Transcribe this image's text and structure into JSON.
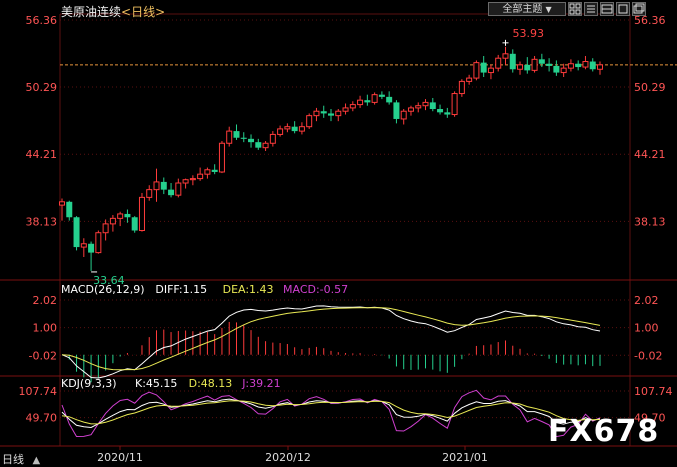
{
  "header": {
    "instrument": "美原油连续",
    "period": "<日线>",
    "theme_button": "全部主题",
    "theme_arrow": "▼"
  },
  "icons": [
    "grid-icon",
    "list-icon",
    "chart-layout-icon",
    "fullscreen-icon",
    "window-icon"
  ],
  "colors": {
    "up": "#ff3b3b",
    "down": "#25d08e",
    "diff": "#ffffff",
    "dea": "#e8e854",
    "macd": "#d040d0",
    "kdj_k": "#ffffff",
    "kdj_d": "#e8e854",
    "kdj_j": "#d040d0",
    "last_price_line": "#e8953c",
    "grid": "#5a1010"
  },
  "watermark": "FX678",
  "footer": {
    "period_label": "日线",
    "scroll_arrow": "▲"
  },
  "chart_data": [
    {
      "type": "candlestick",
      "panel": "price",
      "y_ticks": [
        "56.36",
        "50.29",
        "44.21",
        "38.13"
      ],
      "ylim": [
        33.0,
        56.36
      ],
      "x_ticks": [
        "2020/11",
        "2020/12",
        "2021/01"
      ],
      "high_label": "53.93",
      "low_label": "33.64",
      "last_price": 52.3,
      "candles": [
        [
          39.6,
          40.2,
          38.2,
          39.9
        ],
        [
          39.9,
          40.0,
          38.2,
          38.5
        ],
        [
          38.5,
          38.6,
          35.5,
          35.8
        ],
        [
          35.8,
          36.6,
          34.9,
          36.1
        ],
        [
          36.1,
          36.3,
          33.64,
          35.3
        ],
        [
          35.3,
          37.3,
          35.2,
          37.1
        ],
        [
          37.1,
          38.3,
          36.4,
          37.9
        ],
        [
          37.9,
          38.7,
          37.2,
          38.4
        ],
        [
          38.4,
          39.0,
          37.7,
          38.8
        ],
        [
          38.8,
          39.2,
          38.0,
          38.5
        ],
        [
          38.5,
          38.6,
          37.1,
          37.3
        ],
        [
          37.3,
          40.7,
          37.2,
          40.3
        ],
        [
          40.3,
          41.4,
          40.0,
          41.0
        ],
        [
          41.0,
          42.9,
          39.9,
          41.7
        ],
        [
          41.7,
          42.1,
          40.6,
          41.0
        ],
        [
          41.0,
          41.6,
          40.3,
          40.5
        ],
        [
          40.5,
          42.0,
          40.3,
          41.6
        ],
        [
          41.6,
          42.0,
          41.1,
          41.9
        ],
        [
          41.9,
          42.3,
          41.4,
          42.0
        ],
        [
          42.0,
          43.0,
          41.8,
          42.4
        ],
        [
          42.4,
          43.0,
          42.0,
          42.8
        ],
        [
          42.8,
          43.3,
          42.4,
          42.6
        ],
        [
          42.6,
          45.4,
          42.5,
          45.2
        ],
        [
          45.2,
          46.7,
          44.9,
          46.3
        ],
        [
          46.3,
          46.9,
          45.5,
          45.7
        ],
        [
          45.7,
          46.2,
          45.3,
          45.6
        ],
        [
          45.6,
          46.0,
          44.8,
          45.3
        ],
        [
          45.3,
          45.6,
          44.6,
          44.8
        ],
        [
          44.8,
          45.4,
          44.5,
          45.2
        ],
        [
          45.2,
          46.3,
          44.9,
          46.0
        ],
        [
          46.0,
          46.8,
          45.8,
          46.5
        ],
        [
          46.5,
          47.0,
          46.2,
          46.7
        ],
        [
          46.7,
          47.2,
          46.1,
          46.3
        ],
        [
          46.3,
          47.1,
          46.0,
          46.7
        ],
        [
          46.7,
          47.9,
          46.5,
          47.7
        ],
        [
          47.7,
          48.4,
          47.2,
          48.1
        ],
        [
          48.1,
          48.6,
          47.5,
          47.9
        ],
        [
          47.9,
          48.3,
          47.2,
          47.7
        ],
        [
          47.7,
          48.3,
          47.2,
          48.1
        ],
        [
          48.1,
          48.8,
          47.8,
          48.4
        ],
        [
          48.4,
          49.0,
          48.1,
          48.7
        ],
        [
          48.7,
          49.5,
          48.4,
          49.1
        ],
        [
          49.1,
          49.6,
          48.6,
          48.9
        ],
        [
          48.9,
          49.8,
          48.7,
          49.6
        ],
        [
          49.6,
          49.9,
          49.2,
          49.4
        ],
        [
          49.4,
          49.9,
          48.7,
          48.9
        ],
        [
          48.9,
          49.1,
          47.0,
          47.4
        ],
        [
          47.4,
          48.3,
          46.9,
          48.1
        ],
        [
          48.1,
          48.6,
          47.7,
          48.4
        ],
        [
          48.4,
          48.9,
          48.0,
          48.6
        ],
        [
          48.6,
          49.2,
          48.2,
          48.9
        ],
        [
          48.9,
          49.3,
          48.1,
          48.3
        ],
        [
          48.3,
          48.7,
          47.8,
          48.0
        ],
        [
          48.0,
          48.4,
          47.5,
          47.8
        ],
        [
          47.8,
          49.9,
          47.6,
          49.7
        ],
        [
          49.7,
          51.0,
          49.4,
          50.8
        ],
        [
          50.8,
          51.4,
          50.5,
          51.1
        ],
        [
          51.1,
          52.7,
          50.9,
          52.5
        ],
        [
          52.5,
          53.1,
          51.2,
          51.6
        ],
        [
          51.6,
          52.3,
          51.0,
          52.0
        ],
        [
          52.0,
          53.2,
          51.7,
          52.9
        ],
        [
          52.9,
          53.93,
          52.3,
          53.3
        ],
        [
          53.3,
          53.7,
          51.6,
          51.9
        ],
        [
          51.9,
          52.6,
          51.4,
          52.3
        ],
        [
          52.3,
          53.0,
          51.5,
          51.8
        ],
        [
          51.8,
          53.1,
          51.6,
          52.8
        ],
        [
          52.8,
          53.3,
          52.1,
          52.4
        ],
        [
          52.4,
          52.9,
          51.7,
          52.2
        ],
        [
          52.2,
          52.7,
          51.3,
          51.6
        ],
        [
          51.6,
          52.4,
          51.2,
          52.0
        ],
        [
          52.0,
          52.8,
          51.7,
          52.4
        ],
        [
          52.4,
          52.7,
          51.8,
          52.1
        ],
        [
          52.1,
          53.1,
          51.9,
          52.6
        ],
        [
          52.6,
          52.9,
          51.7,
          51.9
        ],
        [
          51.9,
          52.6,
          51.4,
          52.3
        ]
      ]
    },
    {
      "type": "bar+line",
      "panel": "macd",
      "label": "MACD(26,12,9)",
      "diff_label": "DIFF:1.15",
      "dea_label": "DEA:1.43",
      "macd_label": "MACD:-0.57",
      "y_ticks": [
        "2.02",
        "1.00",
        "-0.02"
      ],
      "ylim": [
        -0.6,
        2.02
      ]
    },
    {
      "type": "line",
      "panel": "kdj",
      "label": "KDJ(9,3,3)",
      "k_label": "K:45.15",
      "d_label": "D:48.13",
      "j_label": "J:39.21",
      "y_ticks": [
        "107.74",
        "49.70"
      ],
      "ylim": [
        -8.0,
        107.74
      ]
    }
  ]
}
